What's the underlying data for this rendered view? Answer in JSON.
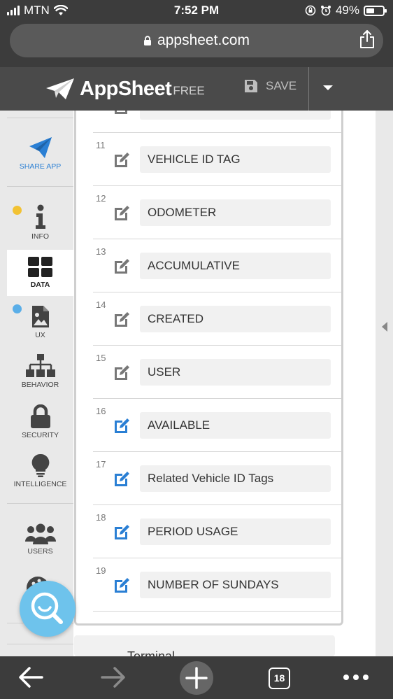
{
  "status_bar": {
    "carrier": "MTN",
    "time": "7:52 PM",
    "battery": "49%",
    "battery_level": 0.49
  },
  "browser": {
    "url": "appsheet.com",
    "tab_count": "18"
  },
  "app_header": {
    "brand": "AppSheet",
    "tier": "FREE",
    "save_label": "SAVE"
  },
  "sidebar": {
    "items": [
      {
        "label": "SHARE APP",
        "icon": "paper-plane-icon"
      },
      {
        "label": "INFO",
        "icon": "info-icon",
        "dot_color": "#f2c233"
      },
      {
        "label": "DATA",
        "icon": "grid-icon",
        "active": true
      },
      {
        "label": "UX",
        "icon": "image-file-icon",
        "dot_color": "#5aaee8"
      },
      {
        "label": "BEHAVIOR",
        "icon": "sitemap-icon"
      },
      {
        "label": "SECURITY",
        "icon": "lock-icon"
      },
      {
        "label": "INTELLIGENCE",
        "icon": "lightbulb-icon"
      },
      {
        "label": "USERS",
        "icon": "users-icon"
      }
    ]
  },
  "columns": {
    "rows": [
      {
        "num": "11",
        "name": "VEHICLE ID TAG",
        "icon_color": "#777777"
      },
      {
        "num": "12",
        "name": "ODOMETER",
        "icon_color": "#777777"
      },
      {
        "num": "13",
        "name": "ACCUMULATIVE",
        "icon_color": "#777777"
      },
      {
        "num": "14",
        "name": "CREATED",
        "icon_color": "#777777"
      },
      {
        "num": "15",
        "name": "USER",
        "icon_color": "#777777"
      },
      {
        "num": "16",
        "name": "AVAILABLE",
        "icon_color": "#2a7fd4"
      },
      {
        "num": "17",
        "name": "Related Vehicle ID Tags",
        "icon_color": "#2a7fd4"
      },
      {
        "num": "18",
        "name": "PERIOD USAGE",
        "icon_color": "#2a7fd4"
      },
      {
        "num": "19",
        "name": "NUMBER OF SUNDAYS",
        "icon_color": "#2a7fd4"
      }
    ]
  },
  "next_table": {
    "title": "Terminal"
  },
  "colors": {
    "fab": "#6ec3ec",
    "accent_blue": "#2a7fd4"
  }
}
